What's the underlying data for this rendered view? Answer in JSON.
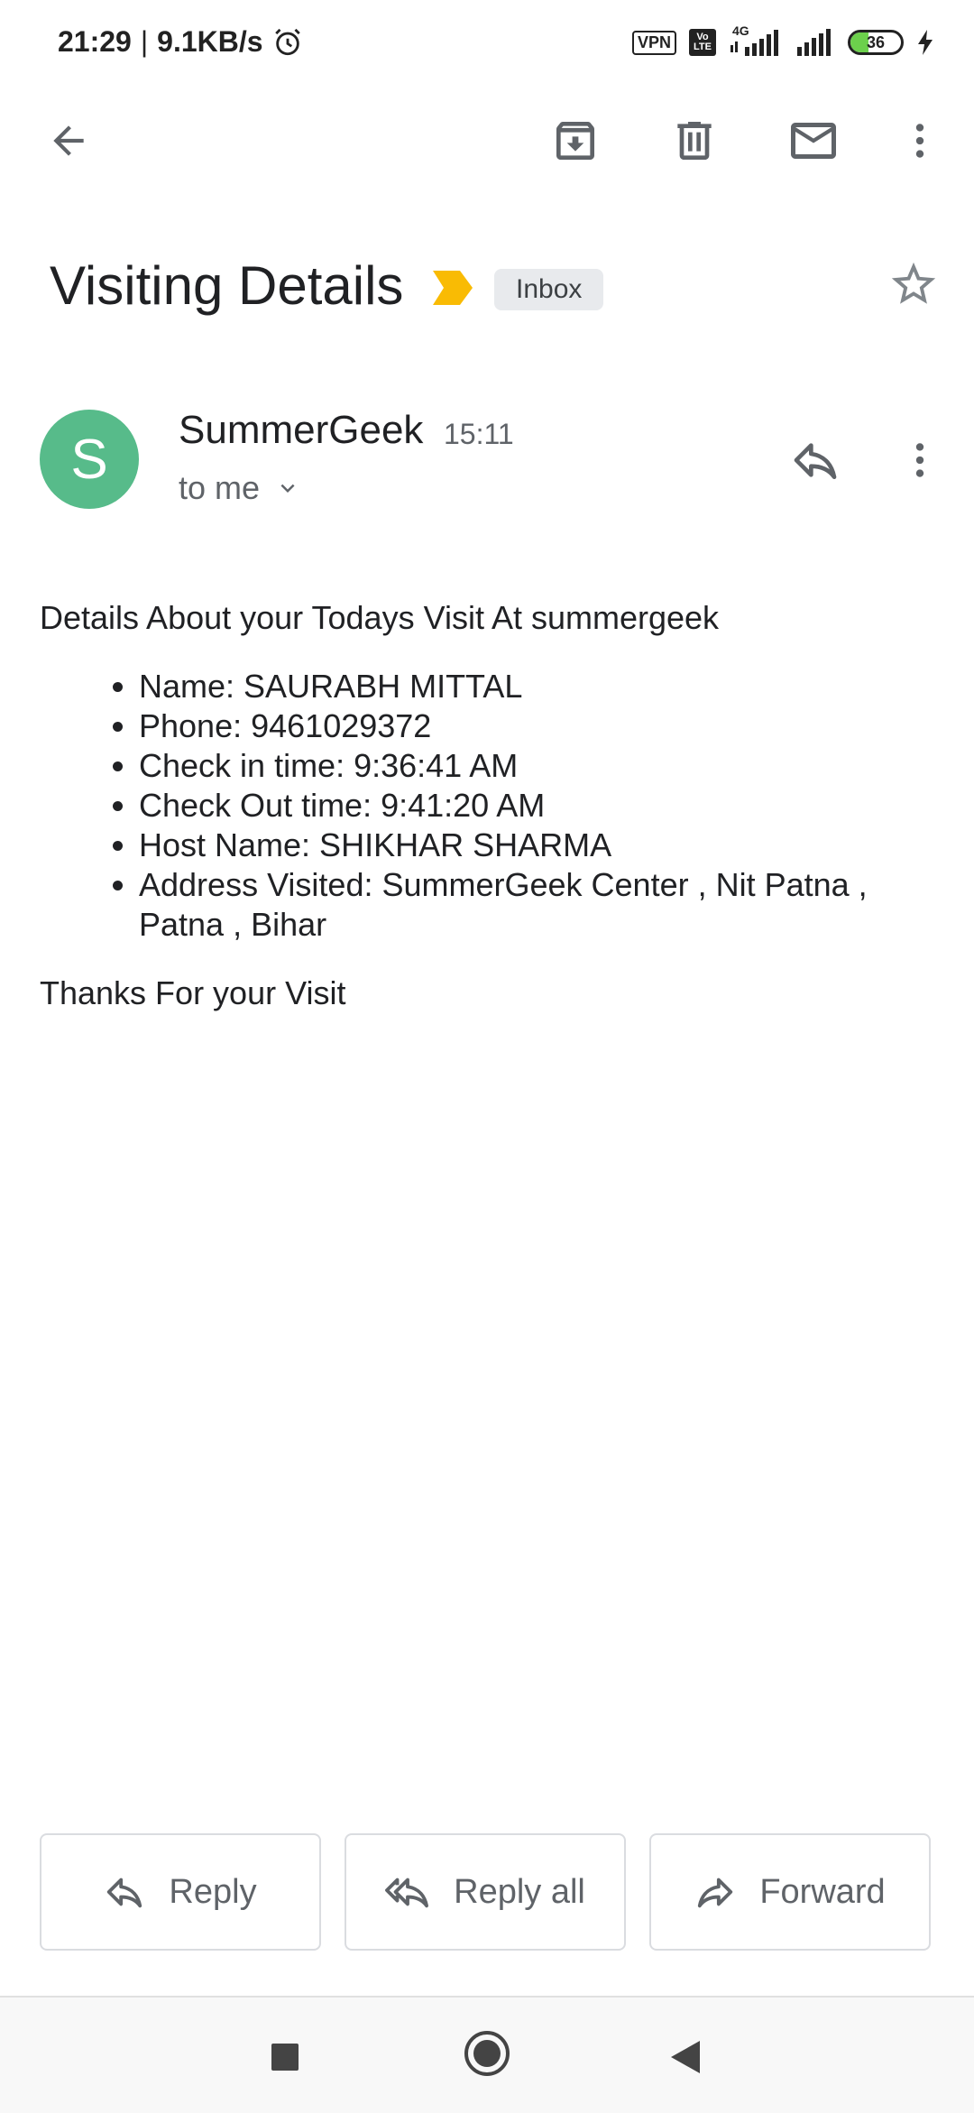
{
  "status_bar": {
    "time": "21:29",
    "separator": "|",
    "speed": "9.1KB/s",
    "vpn_label": "VPN",
    "volte_top": "Vo",
    "volte_bottom": "LTE",
    "network_label": "4G",
    "battery_level": "36",
    "battery_fraction": 0.36
  },
  "toolbar": {
    "back_icon": "arrow-left-icon",
    "archive_icon": "archive-icon",
    "delete_icon": "trash-icon",
    "mark_unread_icon": "mail-icon",
    "more_icon": "more-vert-icon"
  },
  "email": {
    "subject": "Visiting Details",
    "label": "Inbox",
    "importance_color": "#f9bb04",
    "sender_initial": "S",
    "avatar_color": "#57bb8a",
    "sender_name": "SummerGeek",
    "time": "15:11",
    "recipient": "to me",
    "intro": "Details About your Todays Visit At summergeek",
    "details": [
      "Name: SAURABH MITTAL",
      "Phone: 9461029372",
      "Check in time: 9:36:41 AM",
      "Check Out time: 9:41:20 AM",
      "Host Name: SHIKHAR SHARMA",
      "Address Visited: SummerGeek Center , Nit Patna , Patna , Bihar"
    ],
    "closing": "Thanks For your Visit"
  },
  "actions": {
    "reply": "Reply",
    "reply_all": "Reply all",
    "forward": "Forward"
  }
}
